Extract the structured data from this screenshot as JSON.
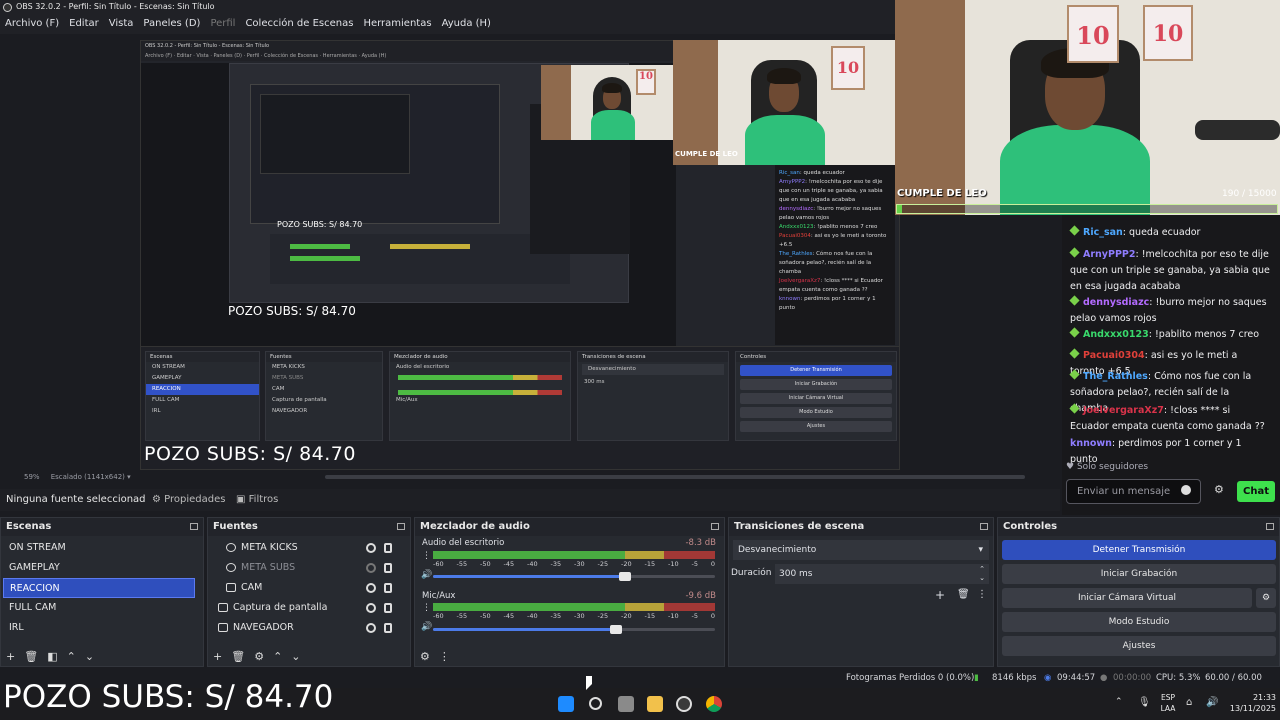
{
  "window": {
    "title": "OBS 32.0.2 - Perfil: Sin Título - Escenas: Sin Título"
  },
  "menu": [
    {
      "label": "Archivo (F)",
      "enabled": true
    },
    {
      "label": "Editar",
      "enabled": true
    },
    {
      "label": "Vista",
      "enabled": true
    },
    {
      "label": "Paneles (D)",
      "enabled": true
    },
    {
      "label": "Perfil",
      "enabled": false
    },
    {
      "label": "Colección de Escenas",
      "enabled": true
    },
    {
      "label": "Herramientas",
      "enabled": true
    },
    {
      "label": "Ayuda (H)",
      "enabled": true
    }
  ],
  "overlay": {
    "pozo": "POZO SUBS: S/ 84.70",
    "cam_label": "CUMPLE DE LEO",
    "goal": "190 / 15000",
    "goal_fraction": 0.0127,
    "frame_text": "10"
  },
  "chat": {
    "messages": [
      {
        "user": "Ric_san",
        "color": "#4ea8ff",
        "text": "queda ecuador"
      },
      {
        "user": "ArnyPPP2",
        "color": "#8f7dff",
        "text": "!melcochita por eso te dije que con un triple se ganaba, ya sabia que en esa jugada acababa"
      },
      {
        "user": "dennysdiazc",
        "color": "#b36bff",
        "text": "!burro mejor no saques pelao vamos rojos"
      },
      {
        "user": "Andxxx0123",
        "color": "#39d96c",
        "text": "!pablito menos 7 creo"
      },
      {
        "user": "Pacuai0304",
        "color": "#e0403a",
        "text": "asi es yo le meti a toronto +6.5"
      },
      {
        "user": "The_Rathles",
        "color": "#4ea8ff",
        "text": "Cómo nos fue con la soñadora pelao?, recién salí de la chamba"
      },
      {
        "user": "JoelvergaraXz7",
        "color": "#d9334a",
        "text": "!closs **** si Ecuador empata cuenta como ganada ??"
      },
      {
        "user": "knnown",
        "color": "#8f7dff",
        "text": "perdimos por 1 corner y 1 punto"
      }
    ],
    "followers_only": "Solo seguidores",
    "input_placeholder": "Enviar un mensaje",
    "send_label": "Chat"
  },
  "preview": {
    "zoom": "59%",
    "scaled": "Escalado (1141x642)"
  },
  "propsbar": {
    "no_source": "Ninguna fuente seleccionad",
    "properties": "Propiedades",
    "filters": "Filtros"
  },
  "scenes": {
    "title": "Escenas",
    "items": [
      "ON STREAM",
      "GAMEPLAY",
      "REACCION",
      "FULL CAM",
      "IRL"
    ],
    "selected": 2
  },
  "sources": {
    "title": "Fuentes",
    "items": [
      {
        "name": "META KICKS",
        "visible": true
      },
      {
        "name": "META SUBS",
        "visible": false
      },
      {
        "name": "CAM",
        "visible": true
      },
      {
        "name": "Captura de pantalla",
        "visible": true
      },
      {
        "name": "NAVEGADOR",
        "visible": true
      }
    ]
  },
  "mixer": {
    "title": "Mezclador de audio",
    "tracks": [
      {
        "name": "Audio del escritorio",
        "db": "-8.3 dB",
        "volume": 0.68
      },
      {
        "name": "Mic/Aux",
        "db": "-9.6 dB",
        "volume": 0.65
      }
    ],
    "ticks": [
      "-60",
      "-55",
      "-50",
      "-45",
      "-40",
      "-35",
      "-30",
      "-25",
      "-20",
      "-15",
      "-10",
      "-5",
      "0"
    ]
  },
  "transitions": {
    "title": "Transiciones de escena",
    "selected": "Desvanecimiento",
    "duration_label": "Duración",
    "duration": "300 ms"
  },
  "controls": {
    "title": "Controles",
    "buttons": [
      "Detener Transmisión",
      "Iniciar Grabación",
      "Iniciar Cámara Virtual",
      "Modo Estudio",
      "Ajustes"
    ]
  },
  "status": {
    "dropped": "Fotogramas Perdidos 0 (0.0%)",
    "bitrate": "8146 kbps",
    "stream_time": "09:44:57",
    "rec_time": "00:00:00",
    "cpu": "CPU: 5.3%",
    "fps": "60.00 / 60.00 FPS"
  },
  "taskbar": {
    "lang_top": "ESP",
    "lang_bottom": "LAA",
    "time": "21:33",
    "date": "13/11/2025"
  },
  "colors": {
    "accent": "#2f4fbd",
    "chat_button": "#3ee04d",
    "shirt": "#2ec07a"
  }
}
